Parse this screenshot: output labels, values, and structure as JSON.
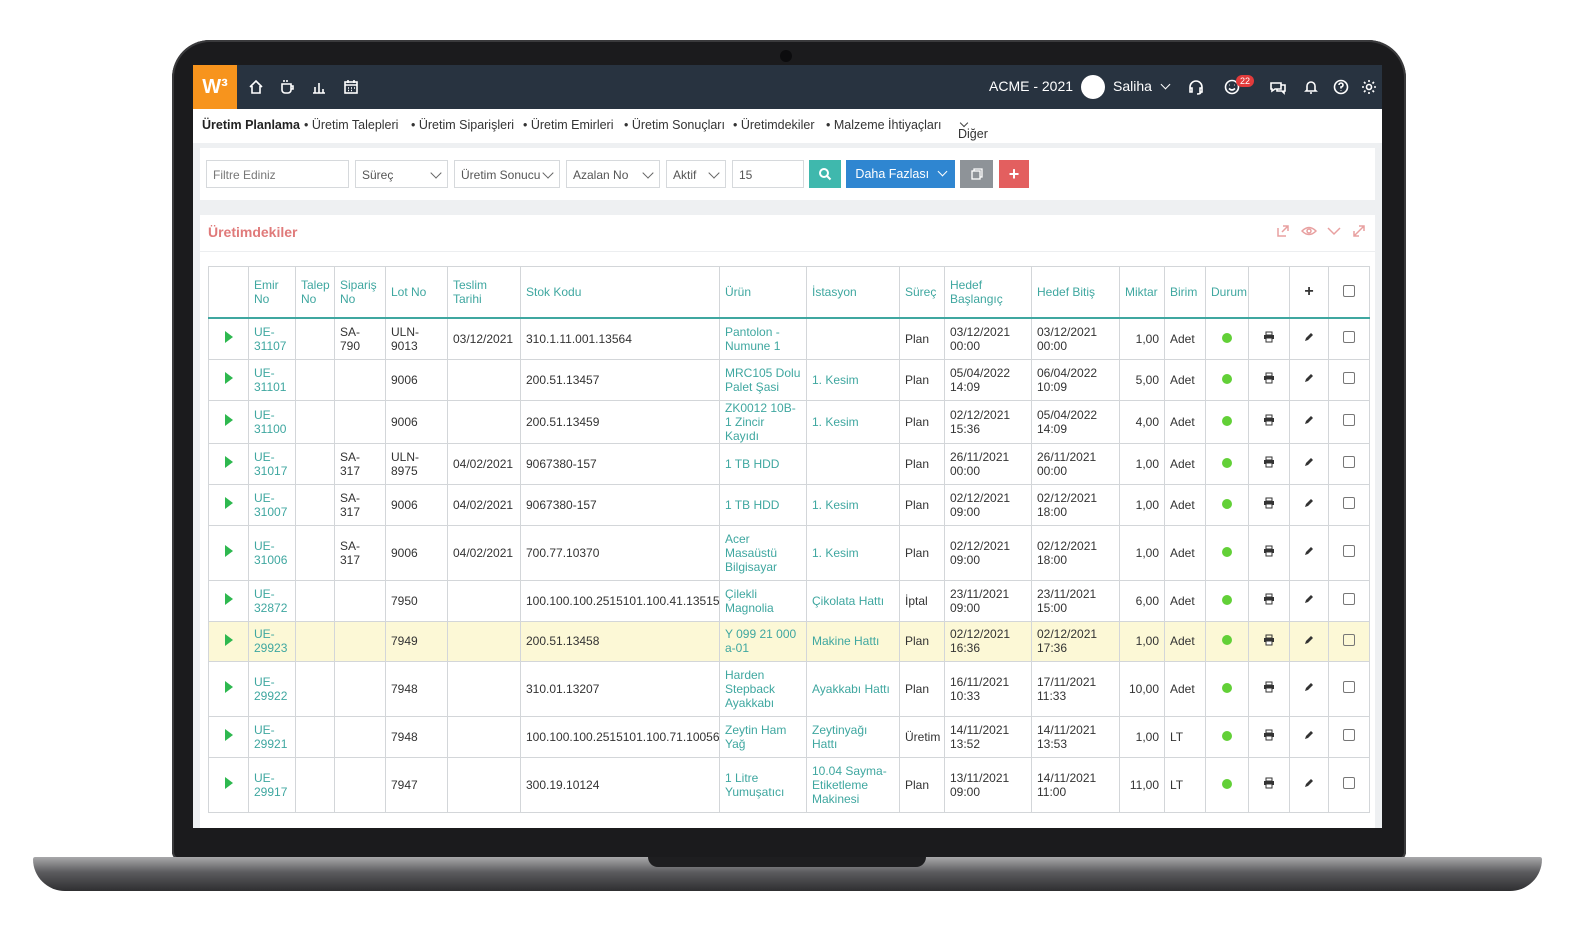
{
  "header": {
    "logo": "W³",
    "company": "ACME - 2021",
    "user": "Saliha",
    "notification_count": "22"
  },
  "subnav": [
    "Üretim Planlama",
    "• Üretim Talepleri",
    "• Üretim Siparişleri",
    "• Üretim Emirleri",
    "• Üretim Sonuçları",
    "• Üretimdekiler",
    "• Malzeme İhtiyaçları",
    "Diğer"
  ],
  "filters": {
    "filter_placeholder": "Filtre Ediniz",
    "process": "Süreç",
    "result": "Üretim Sonucu",
    "order": "Azalan No",
    "status": "Aktif",
    "page_size": "15",
    "more_label": "Daha Fazlası"
  },
  "panel": {
    "title": "Üretimdekiler"
  },
  "table": {
    "headers": [
      "Emir No",
      "Talep No",
      "Sipariş No",
      "Lot No",
      "Teslim Tarihi",
      "Stok Kodu",
      "Ürün",
      "İstasyon",
      "Süreç",
      "Hedef Başlangıç",
      "Hedef Bitiş",
      "Miktar",
      "Birim",
      "Durum"
    ],
    "rows": [
      {
        "emir": "UE-31107",
        "talep": "",
        "siparis": "SA-790",
        "lot": "ULN-9013",
        "teslim": "03/12/2021",
        "stok": "310.1.11.001.13564",
        "urun": "Pantolon - Numune 1",
        "istasyon": "",
        "surec": "Plan",
        "baslangic": "03/12/2021 00:00",
        "bitis": "03/12/2021 00:00",
        "miktar": "1,00",
        "birim": "Adet"
      },
      {
        "emir": "UE-31101",
        "talep": "",
        "siparis": "",
        "lot": "9006",
        "teslim": "",
        "stok": "200.51.13457",
        "urun": "MRC105 Dolu Palet Şasi",
        "istasyon": "1. Kesim",
        "surec": "Plan",
        "baslangic": "05/04/2022 14:09",
        "bitis": "06/04/2022 10:09",
        "miktar": "5,00",
        "birim": "Adet"
      },
      {
        "emir": "UE-31100",
        "talep": "",
        "siparis": "",
        "lot": "9006",
        "teslim": "",
        "stok": "200.51.13459",
        "urun": "ZK0012 10B-1 Zincir Kayıdı",
        "istasyon": "1. Kesim",
        "surec": "Plan",
        "baslangic": "02/12/2021 15:36",
        "bitis": "05/04/2022 14:09",
        "miktar": "4,00",
        "birim": "Adet"
      },
      {
        "emir": "UE-31017",
        "talep": "",
        "siparis": "SA-317",
        "lot": "ULN-8975",
        "teslim": "04/02/2021",
        "stok": "9067380-157",
        "urun": "1 TB HDD",
        "istasyon": "",
        "surec": "Plan",
        "baslangic": "26/11/2021 00:00",
        "bitis": "26/11/2021 00:00",
        "miktar": "1,00",
        "birim": "Adet"
      },
      {
        "emir": "UE-31007",
        "talep": "",
        "siparis": "SA-317",
        "lot": "9006",
        "teslim": "04/02/2021",
        "stok": "9067380-157",
        "urun": "1 TB HDD",
        "istasyon": "1. Kesim",
        "surec": "Plan",
        "baslangic": "02/12/2021 09:00",
        "bitis": "02/12/2021 18:00",
        "miktar": "1,00",
        "birim": "Adet"
      },
      {
        "emir": "UE-31006",
        "talep": "",
        "siparis": "SA-317",
        "lot": "9006",
        "teslim": "04/02/2021",
        "stok": "700.77.10370",
        "urun": "Acer Masaüstü Bilgisayar",
        "istasyon": "1. Kesim",
        "surec": "Plan",
        "baslangic": "02/12/2021 09:00",
        "bitis": "02/12/2021 18:00",
        "miktar": "1,00",
        "birim": "Adet"
      },
      {
        "emir": "UE-32872",
        "talep": "",
        "siparis": "",
        "lot": "7950",
        "teslim": "",
        "stok": "100.100.100.2515101.100.41.13515",
        "urun": "Çilekli Magnolia",
        "istasyon": "Çikolata Hattı",
        "surec": "İptal",
        "baslangic": "23/11/2021 09:00",
        "bitis": "23/11/2021 15:00",
        "miktar": "6,00",
        "birim": "Adet"
      },
      {
        "emir": "UE-29923",
        "talep": "",
        "siparis": "",
        "lot": "7949",
        "teslim": "",
        "stok": "200.51.13458",
        "urun": "Y 099 21 000 a-01",
        "istasyon": "Makine Hattı",
        "surec": "Plan",
        "baslangic": "02/12/2021 16:36",
        "bitis": "02/12/2021 17:36",
        "miktar": "1,00",
        "birim": "Adet"
      },
      {
        "emir": "UE-29922",
        "talep": "",
        "siparis": "",
        "lot": "7948",
        "teslim": "",
        "stok": "310.01.13207",
        "urun": "Harden Stepback Ayakkabı",
        "istasyon": "Ayakkabı Hattı",
        "surec": "Plan",
        "baslangic": "16/11/2021 10:33",
        "bitis": "17/11/2021 11:33",
        "miktar": "10,00",
        "birim": "Adet"
      },
      {
        "emir": "UE-29921",
        "talep": "",
        "siparis": "",
        "lot": "7948",
        "teslim": "",
        "stok": "100.100.100.2515101.100.71.10056",
        "urun": "Zeytin Ham Yağ",
        "istasyon": "Zeytinyağı Hattı",
        "surec": "Üretim",
        "baslangic": "14/11/2021 13:52",
        "bitis": "14/11/2021 13:53",
        "miktar": "1,00",
        "birim": "LT"
      },
      {
        "emir": "UE-29917",
        "talep": "",
        "siparis": "",
        "lot": "7947",
        "teslim": "",
        "stok": "300.19.10124",
        "urun": "1 Litre Yumuşatıcı",
        "istasyon": "10.04 Sayma-Etiketleme Makinesi",
        "surec": "Plan",
        "baslangic": "13/11/2021 09:00",
        "bitis": "14/11/2021 11:00",
        "miktar": "11,00",
        "birim": "LT"
      }
    ]
  },
  "colors": {
    "accent": "#3fa7a0",
    "logo_orange": "#f7941d",
    "topbar": "#283340",
    "search_button": "#3fb8ad",
    "more_button": "#2f86d1",
    "add_button": "#e35f5f",
    "status_active": "#62d037",
    "highlight_row": "#fcf8d6"
  },
  "icons": [
    "home-icon",
    "coffee-icon",
    "chart-icon",
    "calendar-icon",
    "headset-icon",
    "smile-icon",
    "chat-icon",
    "bell-icon",
    "help-icon",
    "gear-icon",
    "search-icon",
    "copy-icon",
    "plus-icon",
    "export-icon",
    "eye-icon",
    "collapse-icon",
    "expand-icon",
    "print-icon",
    "edit-icon",
    "checkbox-icon",
    "play-icon"
  ]
}
